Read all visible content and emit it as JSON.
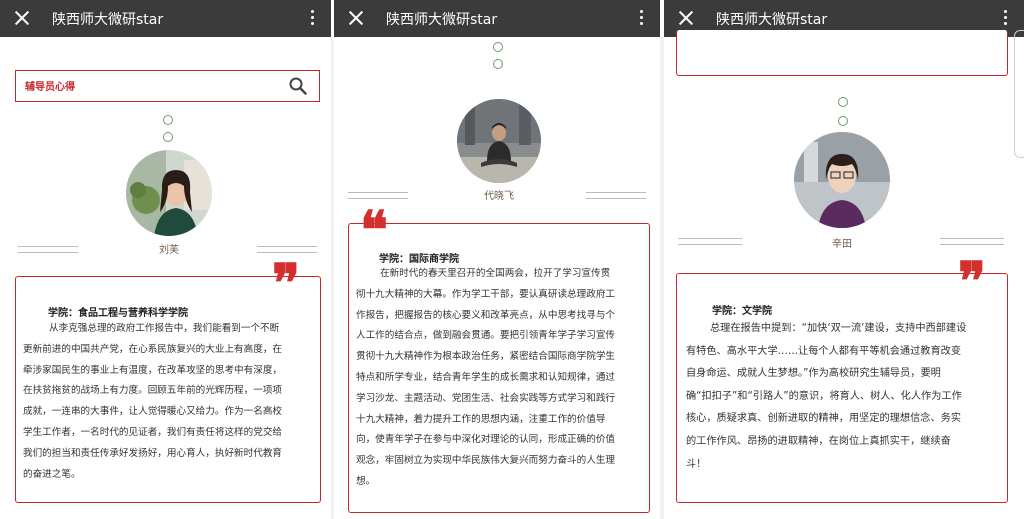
{
  "app_title": "陕西师大微研star",
  "panel1": {
    "search_label": "辅导员心得",
    "name": "刘芙",
    "college": "学院：食品工程与营养科学学院",
    "lines": [
      "从李克强总理的政府工作报告中，我们能看到一个不断",
      "更新前进的中国共产党，在心系民族复兴的大业上有高度，在",
      "牵涉家国民生的事业上有温度，在改革攻坚的思考中有深度，",
      "在扶贫拖贫的战场上有力度。回顾五年前的光辉历程，一项项",
      "成就，一连串的大事件，让人觉得暖心又给力。作为一名高校",
      "学生工作者，一名时代的见证者，我们有责任将这样的党交给",
      "我们的担当和责任传承好发扬好，用心育人，执好新时代教育",
      "的奋进之笔。"
    ]
  },
  "panel2": {
    "name": "代晓飞",
    "college": "学院：国际商学院",
    "lines": [
      "在新时代的春天里召开的全国两会，拉开了学习宣传贯",
      "彻十九大精神的大幕。作为学工干部，要认真研读总理政府工",
      "作报告，把握报告的核心要义和改革亮点，从中思考找寻与个",
      "人工作的结合点，做到融会贯通。要把引领青年学子学习宣传",
      "贯彻十九大精神作为根本政治任务，紧密结合国际商学院学生",
      "特点和所学专业，结合青年学生的成长需求和认知规律，通过",
      "学习沙龙、主题活动、党团生活、社会实践等方式学习和践行",
      "十九大精神，着力提升工作的思想内涵，注重工作的价值导",
      "向，使青年学子在参与中深化对理论的认同，形成正确的价值",
      "观念，牢固树立为实现中华民族伟大复兴而努力奋斗的人生理",
      "想。"
    ]
  },
  "panel3": {
    "name": "辛田",
    "college": "学院：文学院",
    "lines": [
      "总理在报告中提到：“加快‘双一流’建设，支持中西部建设",
      "有特色、高水平大学……让每个人都有平等机会通过教育改变",
      "自身命运、成就人生梦想。”作为高校研究生辅导员，要明",
      "确“扣扣子”和“引路人”的意识，将育人、树人、化人作为工作",
      "核心，质疑求真、创新进取的精神，用坚定的理想信念、务实",
      "的工作作风、昂扬的进取精神，在岗位上真抓实干，继续奋",
      "斗！"
    ]
  },
  "quote_mark": "❞",
  "quote_mark_open": "❝",
  "colors": {
    "accent": "#c62828",
    "topbar": "#3b3b3b",
    "dot": "#6c9b6c"
  },
  "icons": [
    "close-icon",
    "more-icon",
    "search-icon",
    "quote-icon"
  ]
}
